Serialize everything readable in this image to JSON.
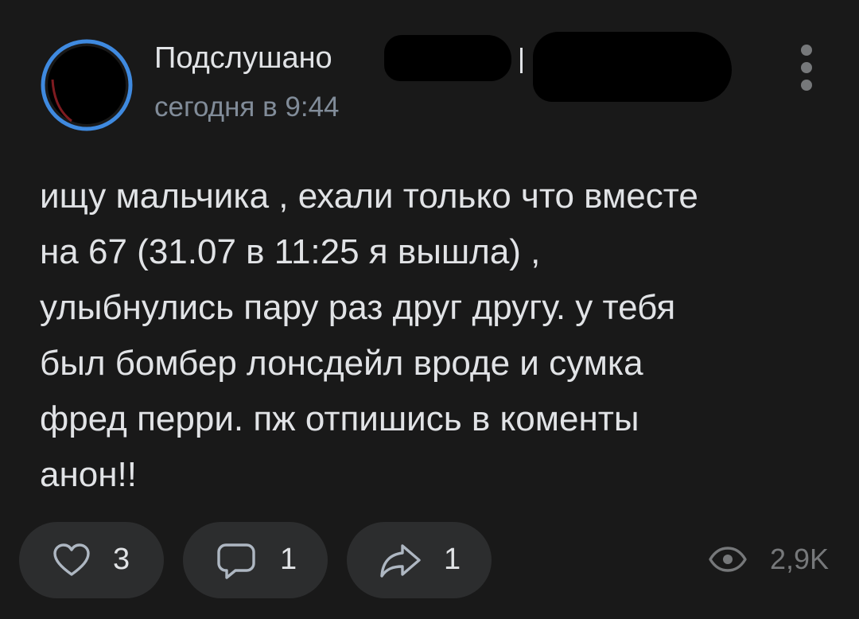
{
  "post": {
    "group_name": "Подслушано",
    "timestamp": "сегодня в 9:44",
    "text_lines": [
      "ищу мальчика , ехали только что вместе",
      "на 67 (31.07 в 11:25 я вышла) ,",
      "улыбнулись пару раз друг другу. у тебя",
      "был бомбер лонсдейл вроде и сумка",
      "фред перри. пж отпишись в коменты",
      "анон!!"
    ]
  },
  "actions": {
    "likes": "3",
    "comments": "1",
    "shares": "1",
    "views": "2,9K"
  },
  "icons": {
    "like": "heart-icon",
    "comment": "comment-bubble-icon",
    "share": "share-arrow-icon",
    "views": "eye-icon",
    "more": "more-vertical-icon"
  },
  "colors": {
    "background": "#191919",
    "button_bg": "#2c2d2e",
    "text_primary": "#e1e3e6",
    "text_secondary": "#818c99",
    "icon_gray": "#76787a",
    "story_ring": "#3f8ae0"
  }
}
